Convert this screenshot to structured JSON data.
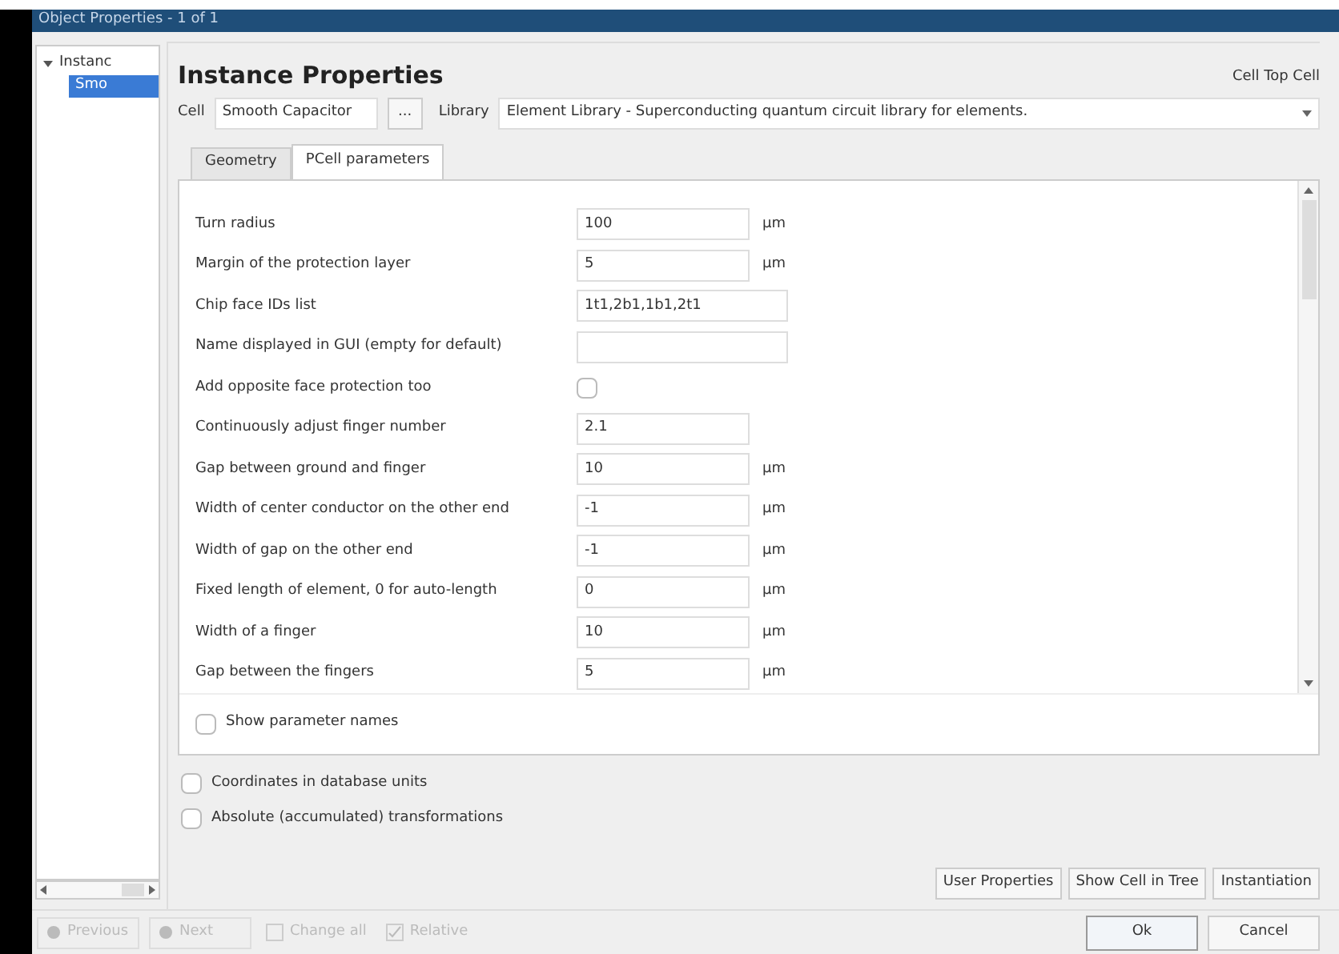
{
  "window": {
    "title": "Object Properties - 1 of 1"
  },
  "tree": {
    "items": [
      {
        "label": "Instanc",
        "expanded": true,
        "selected": false,
        "children": [
          {
            "label": "Smo",
            "selected": true
          }
        ]
      }
    ]
  },
  "header": {
    "title": "Instance Properties",
    "cell_info": "Cell Top Cell"
  },
  "cell_row": {
    "cell_label": "Cell",
    "cell_value": "Smooth Capacitor",
    "browse_button": "...",
    "library_label": "Library",
    "library_value": "Element Library - Superconducting quantum circuit library for elements."
  },
  "tabs": [
    {
      "label": "Geometry",
      "selected": false
    },
    {
      "label": "PCell parameters",
      "selected": true
    }
  ],
  "parameters": [
    {
      "kind": "text",
      "label": "Turn radius",
      "value": "100",
      "unit": "µm",
      "wide": false
    },
    {
      "kind": "text",
      "label": "Margin of the protection layer",
      "value": "5",
      "unit": "µm",
      "wide": false
    },
    {
      "kind": "text",
      "label": "Chip face IDs list",
      "value": "1t1,2b1,1b1,2t1",
      "wide": true
    },
    {
      "kind": "text",
      "label": "Name displayed in GUI (empty for default)",
      "wide": true
    },
    {
      "kind": "checkbox",
      "label": "Add opposite face protection too",
      "checked": false
    },
    {
      "kind": "text",
      "label": "Continuously adjust finger number",
      "value": "2.1",
      "wide": false
    },
    {
      "kind": "text",
      "label": "Gap between ground and finger",
      "value": "10",
      "unit": "µm",
      "wide": false
    },
    {
      "kind": "text",
      "label": "Width of center conductor on the other end",
      "value": "-1",
      "unit": "µm",
      "wide": false
    },
    {
      "kind": "text",
      "label": "Width of gap on the other end",
      "value": "-1",
      "unit": "µm",
      "wide": false
    },
    {
      "kind": "text",
      "label": "Fixed length of element, 0 for auto-length",
      "value": "0",
      "unit": "µm",
      "wide": false
    },
    {
      "kind": "text",
      "label": "Width of a finger",
      "value": "10",
      "unit": "µm",
      "wide": false
    },
    {
      "kind": "text",
      "label": "Gap between the fingers",
      "value": "5",
      "unit": "µm",
      "wide": false
    }
  ],
  "show_parameter_names": {
    "label": "Show parameter names",
    "checked": false
  },
  "options": [
    {
      "label": "Coordinates in database units",
      "checked": false
    },
    {
      "label": "Absolute (accumulated) transformations",
      "checked": false
    }
  ],
  "action_buttons": [
    "User Properties",
    "Show Cell in Tree",
    "Instantiation"
  ],
  "nav_buttons": [
    {
      "kind": "previous",
      "label": "Previous",
      "disabled": true
    },
    {
      "kind": "next",
      "label": "Next",
      "disabled": true
    },
    {
      "kind": "change_all",
      "label": "Change all",
      "disabled": true
    },
    {
      "kind": "relative",
      "label": "Relative",
      "disabled": true
    }
  ],
  "dialog_buttons": [
    {
      "label": "Ok",
      "default": true
    },
    {
      "label": "Cancel",
      "default": false
    }
  ]
}
